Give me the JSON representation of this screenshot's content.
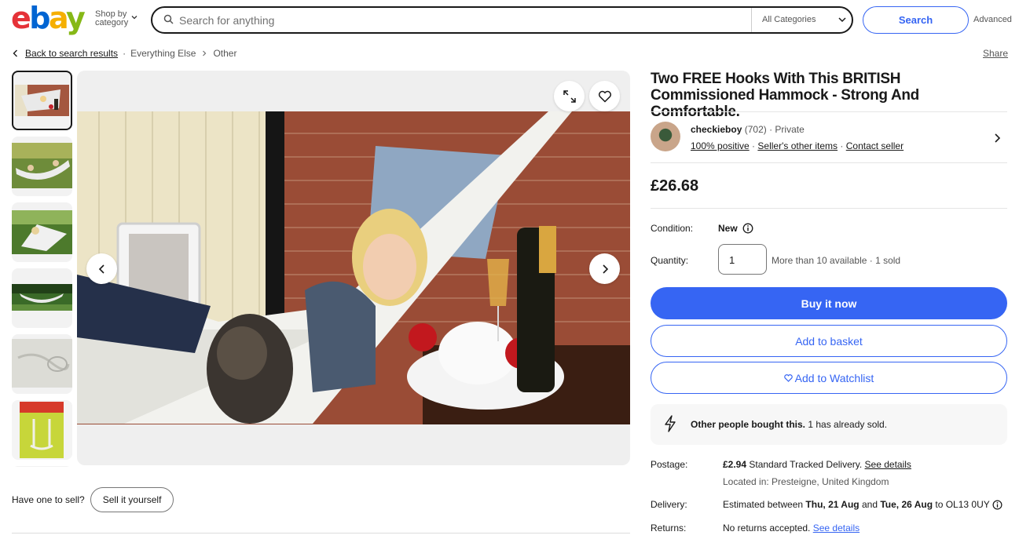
{
  "header": {
    "logo": [
      "e",
      "b",
      "a",
      "y"
    ],
    "shop_by_1": "Shop by",
    "shop_by_2": "category",
    "search_placeholder": "Search for anything",
    "category": "All Categories",
    "search_button": "Search",
    "advanced": "Advanced"
  },
  "breadcrumb": {
    "back": "Back to search results",
    "crumbs": [
      "Everything Else",
      "Other"
    ],
    "share": "Share"
  },
  "gallery": {
    "thumbnail_count": 7,
    "selected_index": 0
  },
  "sell": {
    "prompt": "Have one to sell?",
    "button": "Sell it yourself"
  },
  "listing": {
    "title": "Two FREE Hooks With This BRITISH Commissioned Hammock - Strong And Comfortable.",
    "seller": {
      "name": "checkieboy",
      "feedback": "(702)",
      "type": "· Private",
      "positive": "100% positive",
      "other_items": "Seller's other items",
      "contact": "Contact seller"
    },
    "price": "£26.68",
    "condition_label": "Condition:",
    "condition": "New",
    "quantity_label": "Quantity:",
    "quantity": "1",
    "availability": "More than 10 available · 1 sold",
    "buy_now": "Buy it now",
    "add_basket": "Add to basket",
    "add_watchlist": "Add to Watchlist",
    "notice_bold": "Other people bought this.",
    "notice_rest": " 1 has already sold.",
    "postage_label": "Postage:",
    "postage_price": "£2.94",
    "postage_text": " Standard Tracked Delivery. ",
    "postage_link": "See details",
    "location": "Located in: Presteigne, United Kingdom",
    "delivery_label": "Delivery:",
    "delivery_pre": "Estimated between ",
    "delivery_from": "Thu, 21 Aug",
    "delivery_and": " and ",
    "delivery_to": "Tue, 26 Aug",
    "delivery_post": " to OL13 0UY",
    "returns_label": "Returns:",
    "returns_text": "No returns accepted. ",
    "returns_link": "See details"
  },
  "colors": {
    "accent": "#3665f3",
    "text": "#191919",
    "muted": "#555555"
  }
}
